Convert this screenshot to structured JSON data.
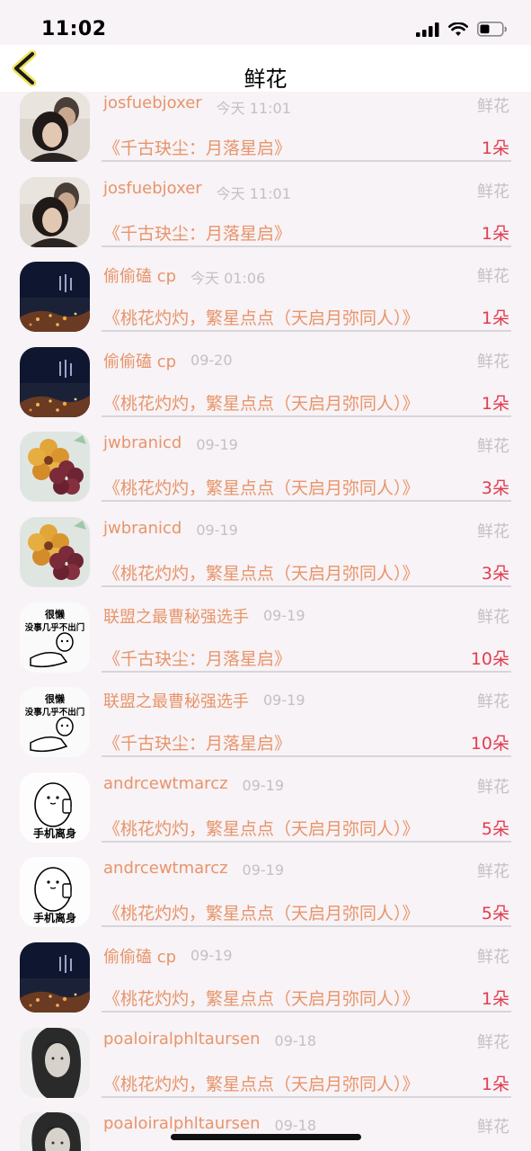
{
  "status_bar": {
    "time": "11:02"
  },
  "nav": {
    "title": "鲜花"
  },
  "gift_records": [
    {
      "username": "josfuebjoxer",
      "time": "今天 11:01",
      "type": "鲜花",
      "book": "《千古玦尘：月落星启》",
      "count": "1朵",
      "avatar": "couple"
    },
    {
      "username": "josfuebjoxer",
      "time": "今天 11:01",
      "type": "鲜花",
      "book": "《千古玦尘：月落星启》",
      "count": "1朵",
      "avatar": "couple"
    },
    {
      "username": "偷偷磕 cp",
      "time": "今天 01:06",
      "type": "鲜花",
      "book": "《桃花灼灼，繁星点点（天启月弥同人）》",
      "count": "1朵",
      "avatar": "night"
    },
    {
      "username": "偷偷磕 cp",
      "time": "09-20",
      "type": "鲜花",
      "book": "《桃花灼灼，繁星点点（天启月弥同人）》",
      "count": "1朵",
      "avatar": "night"
    },
    {
      "username": "jwbranicd",
      "time": "09-19",
      "type": "鲜花",
      "book": "《桃花灼灼，繁星点点（天启月弥同人）》",
      "count": "3朵",
      "avatar": "flower"
    },
    {
      "username": "jwbranicd",
      "time": "09-19",
      "type": "鲜花",
      "book": "《桃花灼灼，繁星点点（天启月弥同人）》",
      "count": "3朵",
      "avatar": "flower"
    },
    {
      "username": "联盟之最曹秘强选手",
      "time": "09-19",
      "type": "鲜花",
      "book": "《千古玦尘：月落星启》",
      "count": "10朵",
      "avatar": "meme-lazy",
      "avatar_text_1": "很懒",
      "avatar_text_2": "没事几乎不出门"
    },
    {
      "username": "联盟之最曹秘强选手",
      "time": "09-19",
      "type": "鲜花",
      "book": "《千古玦尘：月落星启》",
      "count": "10朵",
      "avatar": "meme-lazy",
      "avatar_text_1": "很懒",
      "avatar_text_2": "没事几乎不出门"
    },
    {
      "username": "andrcewtmarcz",
      "time": "09-19",
      "type": "鲜花",
      "book": "《桃花灼灼，繁星点点（天启月弥同人）》",
      "count": "5朵",
      "avatar": "meme-phone",
      "avatar_text_1": "手机离身"
    },
    {
      "username": "andrcewtmarcz",
      "time": "09-19",
      "type": "鲜花",
      "book": "《桃花灼灼，繁星点点（天启月弥同人）》",
      "count": "5朵",
      "avatar": "meme-phone",
      "avatar_text_1": "手机离身"
    },
    {
      "username": "偷偷磕 cp",
      "time": "09-19",
      "type": "鲜花",
      "book": "《桃花灼灼，繁星点点（天启月弥同人）》",
      "count": "1朵",
      "avatar": "night"
    },
    {
      "username": "poaloiralphltaursen",
      "time": "09-18",
      "type": "鲜花",
      "book": "《桃花灼灼，繁星点点（天启月弥同人）》",
      "count": "1朵",
      "avatar": "woman"
    },
    {
      "username": "poaloiralphltaursen",
      "time": "09-18",
      "type": "鲜花",
      "book": "",
      "count": "",
      "avatar": "woman"
    }
  ]
}
